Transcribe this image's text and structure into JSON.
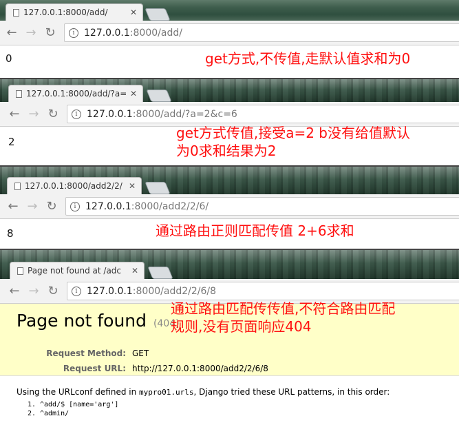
{
  "panels": [
    {
      "tab_title": "127.0.0.1:8000/add/",
      "url_host": "127.0.0.1",
      "url_rest": ":8000/add/",
      "result": "0",
      "annotation_lines": [
        "get方式,不传值,走默认值求和为0"
      ]
    },
    {
      "tab_title": "127.0.0.1:8000/add/?a=",
      "url_host": "127.0.0.1",
      "url_rest": ":8000/add/?a=2&c=6",
      "result": "2",
      "annotation_lines": [
        "get方式传值,接受a=2 b没有给值默认",
        "为0求和结果为2"
      ]
    },
    {
      "tab_title": "127.0.0.1:8000/add2/2/",
      "url_host": "127.0.0.1",
      "url_rest": ":8000/add2/2/6/",
      "result": "8",
      "annotation_lines": [
        "通过路由正则匹配传值 2+6求和"
      ]
    },
    {
      "tab_title": "Page not found at /adc",
      "url_host": "127.0.0.1",
      "url_rest": ":8000/add2/2/6/8",
      "annotation_lines": [
        "通过路由匹配传传值,不符合路由匹配",
        "规则,没有页面响应404"
      ]
    }
  ],
  "icons": {
    "back": "back-arrow-icon",
    "forward": "forward-arrow-icon",
    "reload": "reload-icon",
    "info": "info-icon",
    "page": "page-icon",
    "close": "close-icon"
  },
  "django": {
    "title": "Page not found",
    "code": "(404)",
    "method_label": "Request Method:",
    "method_value": "GET",
    "url_label": "Request URL:",
    "url_value": "http://127.0.0.1:8000/add2/2/6/8",
    "urlconf_prefix": "Using the URLconf defined in ",
    "urlconf_module": "mypro01.urls",
    "urlconf_suffix": ", Django tried these URL patterns, in this order:",
    "patterns": [
      "^add/$ [name='arg']",
      "^admin/"
    ]
  },
  "colors": {
    "annotation": "#ff1010",
    "django_header_bg": "#ffffc8"
  }
}
